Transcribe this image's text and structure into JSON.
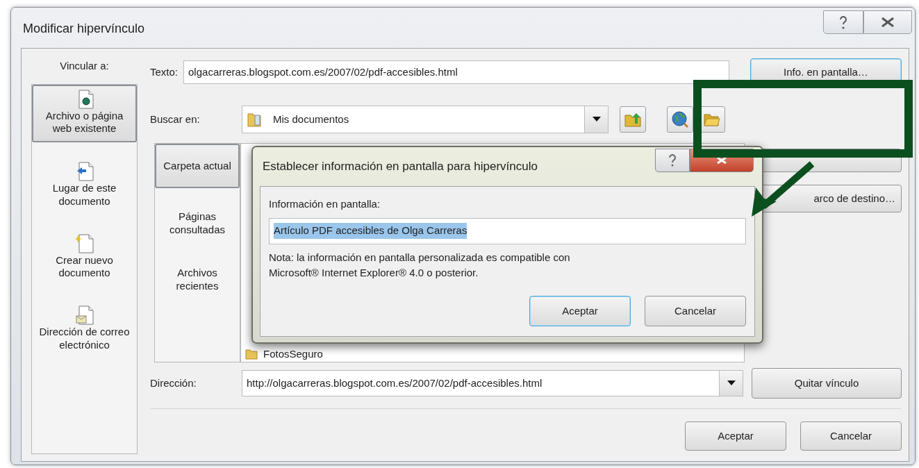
{
  "window": {
    "title": "Modificar hipervínculo"
  },
  "link_to": {
    "label": "Vincular a:",
    "items": [
      {
        "kind": "file",
        "label": "Archivo o página web existente",
        "selected": true
      },
      {
        "kind": "place",
        "label": "Lugar de este documento",
        "selected": false
      },
      {
        "kind": "new",
        "label": "Crear nuevo documento",
        "selected": false
      },
      {
        "kind": "mail",
        "label": "Dirección de correo electrónico",
        "selected": false
      }
    ]
  },
  "text_field": {
    "label": "Texto:",
    "value": "olgacarreras.blogspot.com.es/2007/02/pdf-accesibles.html"
  },
  "info_button": "Info. en pantalla…",
  "look_in": {
    "label": "Buscar en:",
    "value": "Mis documentos"
  },
  "source_tabs": [
    {
      "label": "Carpeta actual",
      "selected": true
    },
    {
      "label": "Páginas consultadas",
      "selected": false
    },
    {
      "label": "Archivos recientes",
      "selected": false
    }
  ],
  "files": [
    {
      "name": "FotosSeguro"
    }
  ],
  "target_frame_button": "arco de destino…",
  "address": {
    "label": "Dirección:",
    "value": "http://olgacarreras.blogspot.com.es/2007/02/pdf-accesibles.html"
  },
  "remove_link_button": "Quitar vínculo",
  "footer_buttons": [
    {
      "label": "Aceptar",
      "default": false
    },
    {
      "label": "Cancelar",
      "default": false
    }
  ],
  "tooltip_dialog": {
    "title": "Establecer información en pantalla para hipervínculo",
    "field_label": "Información en pantalla:",
    "value": "Artículo PDF accesibles de Olga Carreras",
    "highlighted": true,
    "note": "Nota: la información en pantalla personalizada es compatible con Microsoft® Internet Explorer® 4.0 o posterior.",
    "buttons": [
      {
        "label": "Aceptar",
        "default": true
      },
      {
        "label": "Cancelar",
        "default": false
      }
    ]
  }
}
